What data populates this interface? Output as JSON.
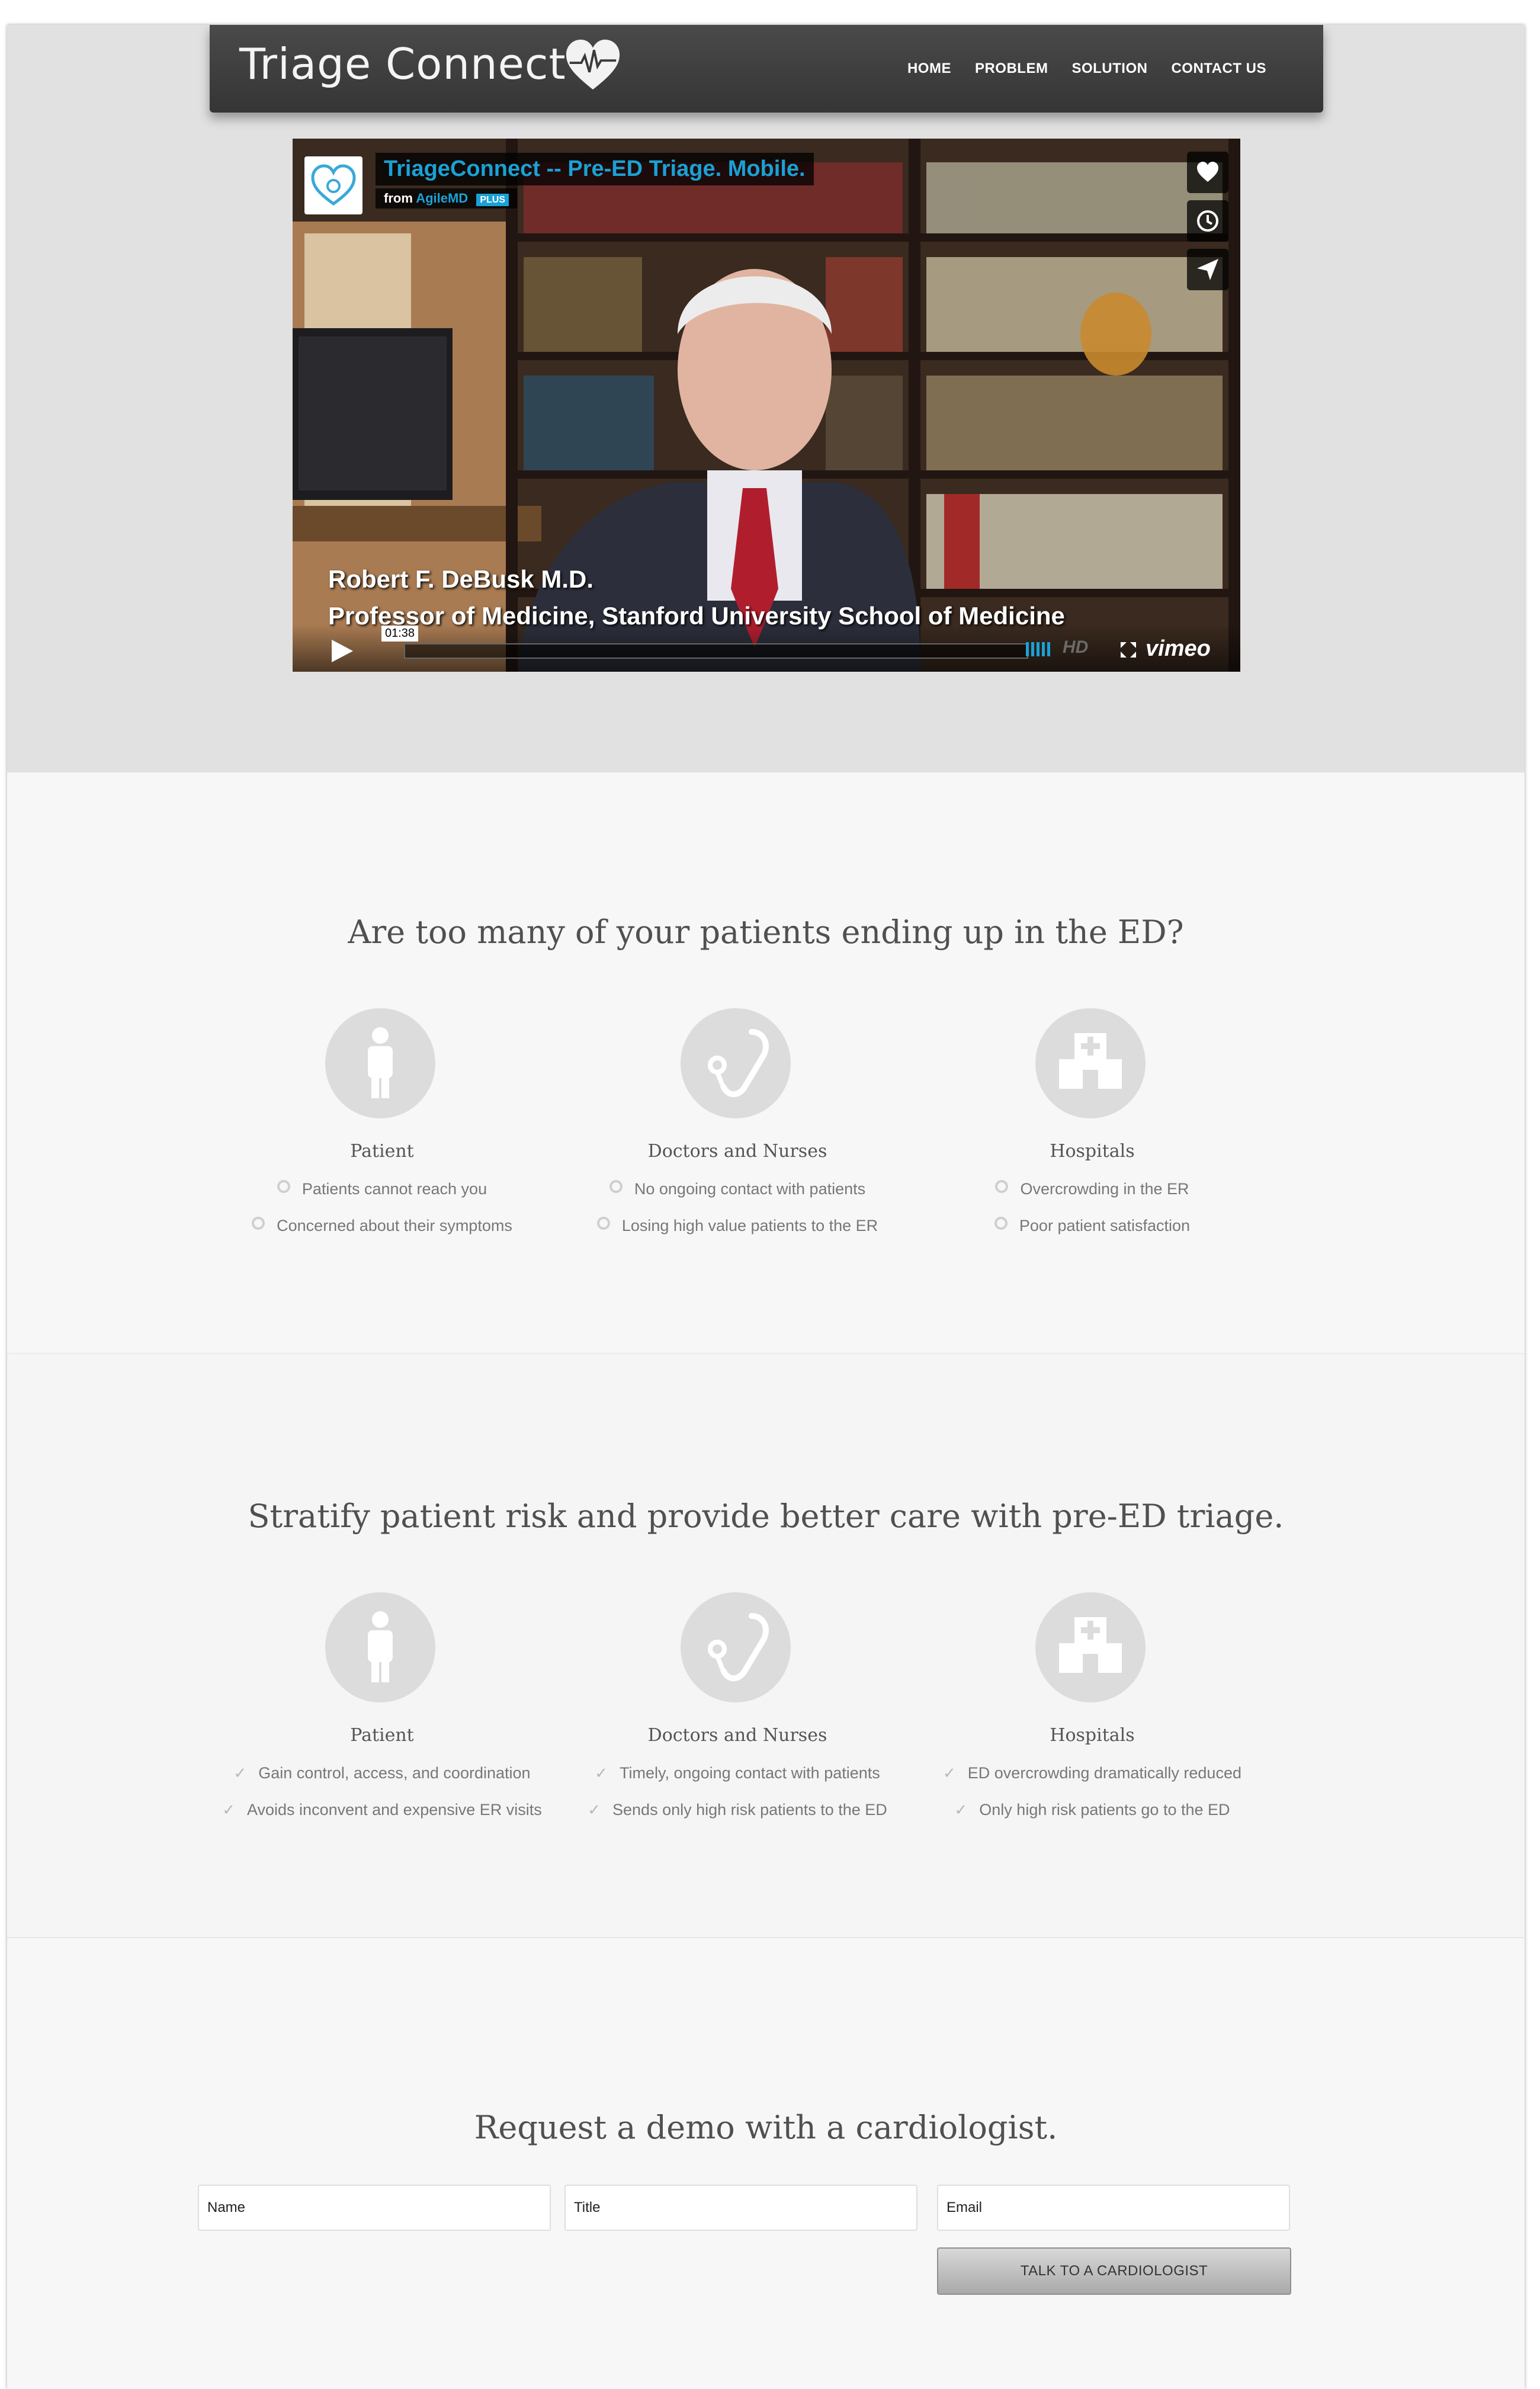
{
  "brand": {
    "name": "Triage Connect",
    "logo_icon": "heart-pulse-icon"
  },
  "nav": {
    "items": [
      "HOME",
      "PROBLEM",
      "SOLUTION",
      "CONTACT US"
    ]
  },
  "video": {
    "title": "TriageConnect -- Pre-ED Triage. Mobile.",
    "from_label": "from",
    "from_name": "AgileMD",
    "badge": "PLUS",
    "caption_name": "Robert F. DeBusk M.D.",
    "caption_role": "Professor of Medicine, Stanford University School of Medicine",
    "time": "01:38",
    "hd": "HD",
    "player_brand": "vimeo",
    "side_icons": [
      "heart-icon",
      "clock-icon",
      "send-icon"
    ]
  },
  "problem": {
    "title": "Are too many of your patients ending up in the ED?",
    "columns": [
      {
        "icon": "person-icon",
        "title": "Patient",
        "items": [
          "Patients cannot reach you",
          "Concerned about their symptoms"
        ]
      },
      {
        "icon": "stethoscope-icon",
        "title": "Doctors and Nurses",
        "items": [
          "No ongoing contact with patients",
          "Losing high value patients to the ER"
        ]
      },
      {
        "icon": "hospital-icon",
        "title": "Hospitals",
        "items": [
          "Overcrowding in the ER",
          "Poor patient satisfaction"
        ]
      }
    ]
  },
  "solution": {
    "title": "Stratify patient risk and provide better care with pre-ED triage.",
    "columns": [
      {
        "icon": "person-icon",
        "title": "Patient",
        "items": [
          "Gain control, access, and coordination",
          "Avoids inconvent and expensive ER visits"
        ]
      },
      {
        "icon": "stethoscope-icon",
        "title": "Doctors and Nurses",
        "items": [
          "Timely, ongoing contact with patients",
          "Sends only high risk patients to the ED"
        ]
      },
      {
        "icon": "hospital-icon",
        "title": "Hospitals",
        "items": [
          "ED overcrowding dramatically reduced",
          "Only high risk patients go to the ED"
        ]
      }
    ]
  },
  "demo": {
    "title": "Request a demo with a cardiologist.",
    "name_placeholder": "Name",
    "title_placeholder": "Title",
    "email_placeholder": "Email",
    "submit_label": "TALK TO A CARDIOLOGIST"
  }
}
